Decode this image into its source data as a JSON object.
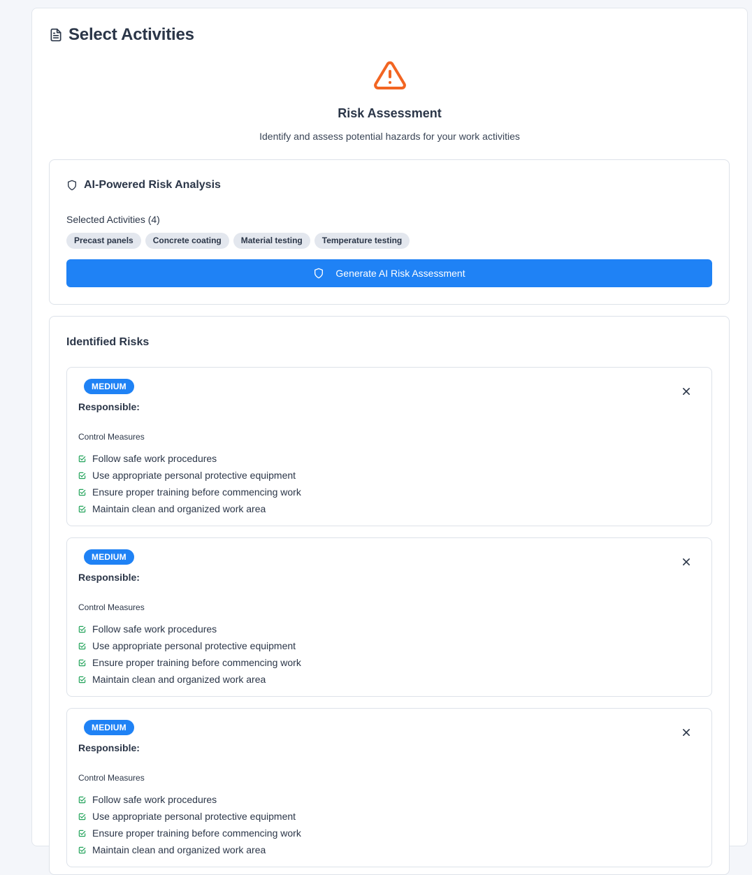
{
  "header": {
    "title": "Select Activities",
    "icon": "document-icon"
  },
  "hero": {
    "icon": "warning-triangle-icon",
    "icon_color": "#f26522",
    "title": "Risk Assessment",
    "subtitle": "Identify and assess potential hazards for your work activities"
  },
  "ai_panel": {
    "title": "AI-Powered Risk Analysis",
    "selected_label": "Selected Activities (4)",
    "activities": [
      {
        "label": "Precast panels"
      },
      {
        "label": "Concrete coating"
      },
      {
        "label": "Material testing"
      },
      {
        "label": "Temperature testing"
      }
    ],
    "generate_label": "Generate AI Risk Assessment",
    "accent": "#1f82f5"
  },
  "risks": {
    "title": "Identified Risks",
    "items": [
      {
        "level": "MEDIUM",
        "responsible_label": "Responsible:",
        "control_label": "Control Measures",
        "measures": [
          "Follow safe work procedures",
          "Use appropriate personal protective equipment",
          "Ensure proper training before commencing work",
          "Maintain clean and organized work area"
        ]
      },
      {
        "level": "MEDIUM",
        "responsible_label": "Responsible:",
        "control_label": "Control Measures",
        "measures": [
          "Follow safe work procedures",
          "Use appropriate personal protective equipment",
          "Ensure proper training before commencing work",
          "Maintain clean and organized work area"
        ]
      },
      {
        "level": "MEDIUM",
        "responsible_label": "Responsible:",
        "control_label": "Control Measures",
        "measures": [
          "Follow safe work procedures",
          "Use appropriate personal protective equipment",
          "Ensure proper training before commencing work",
          "Maintain clean and organized work area"
        ]
      }
    ]
  }
}
